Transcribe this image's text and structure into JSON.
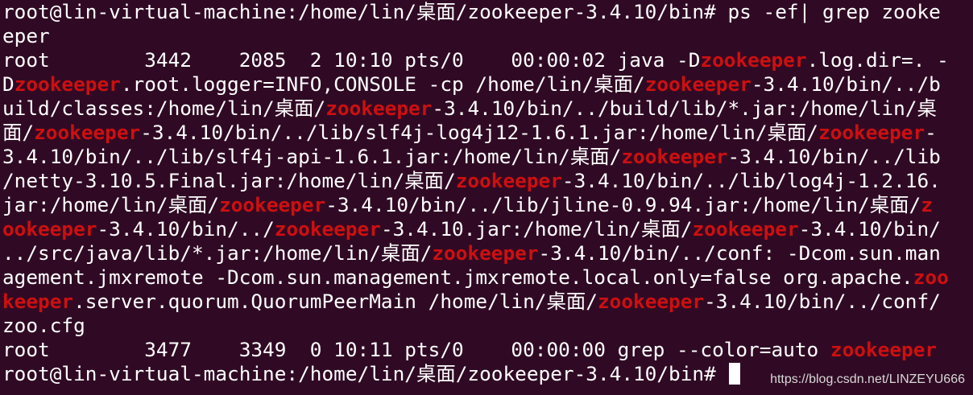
{
  "theme": {
    "background": "#300a24",
    "foreground": "#ffffff",
    "highlight": "#ce0f10"
  },
  "terminal": {
    "lines": [
      [
        {
          "t": "root@lin-virtual-machine:/home/lin/桌面/zookeeper-3.4.10/bin# ps -ef| grep zooke"
        }
      ],
      [
        {
          "t": "eper"
        }
      ],
      [
        {
          "t": "root        3442    2085  2 10:10 pts/0    00:00:02 java -D"
        },
        {
          "t": "zookeeper",
          "h": true
        },
        {
          "t": ".log.dir=. -"
        }
      ],
      [
        {
          "t": "D"
        },
        {
          "t": "zookeeper",
          "h": true
        },
        {
          "t": ".root.logger=INFO,CONSOLE -cp /home/lin/桌面/"
        },
        {
          "t": "zookeeper",
          "h": true
        },
        {
          "t": "-3.4.10/bin/../b"
        }
      ],
      [
        {
          "t": "uild/classes:/home/lin/桌面/"
        },
        {
          "t": "zookeeper",
          "h": true
        },
        {
          "t": "-3.4.10/bin/../build/lib/*.jar:/home/lin/桌"
        }
      ],
      [
        {
          "t": "面/"
        },
        {
          "t": "zookeeper",
          "h": true
        },
        {
          "t": "-3.4.10/bin/../lib/slf4j-log4j12-1.6.1.jar:/home/lin/桌面/"
        },
        {
          "t": "zookeeper",
          "h": true
        },
        {
          "t": "-"
        }
      ],
      [
        {
          "t": "3.4.10/bin/../lib/slf4j-api-1.6.1.jar:/home/lin/桌面/"
        },
        {
          "t": "zookeeper",
          "h": true
        },
        {
          "t": "-3.4.10/bin/../lib"
        }
      ],
      [
        {
          "t": "/netty-3.10.5.Final.jar:/home/lin/桌面/"
        },
        {
          "t": "zookeeper",
          "h": true
        },
        {
          "t": "-3.4.10/bin/../lib/log4j-1.2.16."
        }
      ],
      [
        {
          "t": "jar:/home/lin/桌面/"
        },
        {
          "t": "zookeeper",
          "h": true
        },
        {
          "t": "-3.4.10/bin/../lib/jline-0.9.94.jar:/home/lin/桌面/"
        },
        {
          "t": "z",
          "h": true
        }
      ],
      [
        {
          "t": "ookeeper",
          "h": true
        },
        {
          "t": "-3.4.10/bin/../"
        },
        {
          "t": "zookeeper",
          "h": true
        },
        {
          "t": "-3.4.10.jar:/home/lin/桌面/"
        },
        {
          "t": "zookeeper",
          "h": true
        },
        {
          "t": "-3.4.10/bin/"
        }
      ],
      [
        {
          "t": "../src/java/lib/*.jar:/home/lin/桌面/"
        },
        {
          "t": "zookeeper",
          "h": true
        },
        {
          "t": "-3.4.10/bin/../conf: -Dcom.sun.man"
        }
      ],
      [
        {
          "t": "agement.jmxremote -Dcom.sun.management.jmxremote.local.only=false org.apache."
        },
        {
          "t": "zoo",
          "h": true
        }
      ],
      [
        {
          "t": "keeper",
          "h": true
        },
        {
          "t": ".server.quorum.QuorumPeerMain /home/lin/桌面/"
        },
        {
          "t": "zookeeper",
          "h": true
        },
        {
          "t": "-3.4.10/bin/../conf/"
        }
      ],
      [
        {
          "t": "zoo.cfg"
        }
      ],
      [
        {
          "t": "root        3477    3349  0 10:11 pts/0    00:00:00 grep --color=auto "
        },
        {
          "t": "zookeeper",
          "h": true
        }
      ],
      [
        {
          "t": "root@lin-virtual-machine:/home/lin/桌面/zookeeper-3.4.10/bin# "
        }
      ]
    ]
  },
  "watermark": {
    "text": "https://blog.csdn.net/LINZEYU666"
  }
}
